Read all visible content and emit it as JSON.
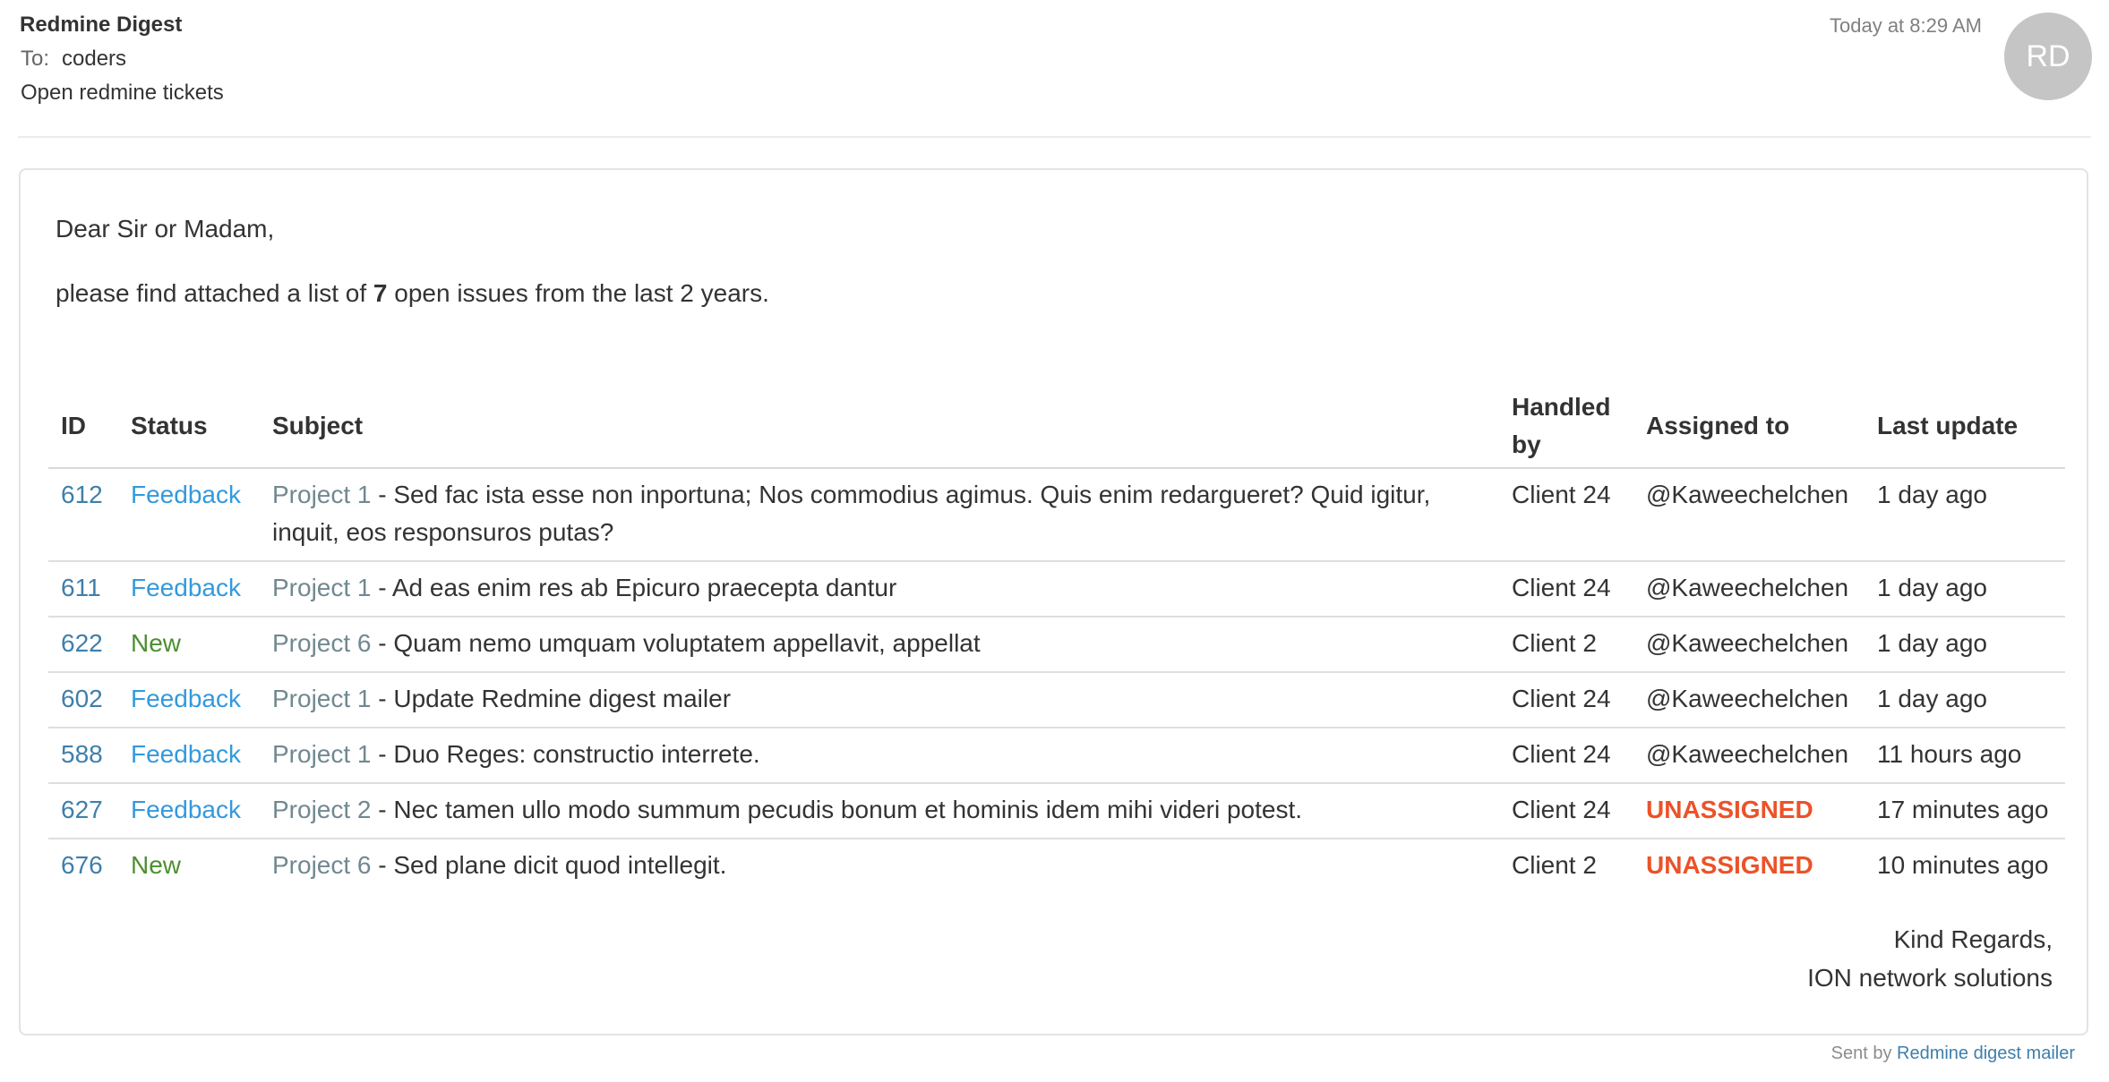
{
  "mail": {
    "sender": "Redmine Digest",
    "to_label": "To:",
    "to_value": "coders",
    "subject": "Open redmine tickets",
    "timestamp": "Today at 8:29 AM",
    "avatar_initials": "RD"
  },
  "body": {
    "greeting": "Dear Sir or Madam,",
    "intro_prefix": "please find attached a list of ",
    "intro_count": "7",
    "intro_suffix": " open issues from the last 2 years.",
    "closing_line1": "Kind Regards,",
    "closing_line2": "ION network solutions"
  },
  "table": {
    "headers": [
      "ID",
      "Status",
      "Subject",
      "Handled by",
      "Assigned to",
      "Last update"
    ],
    "rows": [
      {
        "id": "612",
        "status": "Feedback",
        "status_type": "feedback",
        "project": "Project 1",
        "subject": " - Sed fac ista esse non inportuna; Nos commodius agimus. Quis enim redargueret? Quid igitur, inquit, eos responsuros putas?",
        "handled_by": "Client 24",
        "assigned_to": "@Kaweechelchen",
        "assigned_type": "user",
        "last_update": "1 day ago"
      },
      {
        "id": "611",
        "status": "Feedback",
        "status_type": "feedback",
        "project": "Project 1",
        "subject": " - Ad eas enim res ab Epicuro praecepta dantur",
        "handled_by": "Client 24",
        "assigned_to": "@Kaweechelchen",
        "assigned_type": "user",
        "last_update": "1 day ago"
      },
      {
        "id": "622",
        "status": "New",
        "status_type": "new",
        "project": "Project 6",
        "subject": " - Quam nemo umquam voluptatem appellavit, appellat",
        "handled_by": "Client 2",
        "assigned_to": "@Kaweechelchen",
        "assigned_type": "user",
        "last_update": "1 day ago"
      },
      {
        "id": "602",
        "status": "Feedback",
        "status_type": "feedback",
        "project": "Project 1",
        "subject": " - Update Redmine digest mailer",
        "handled_by": "Client 24",
        "assigned_to": "@Kaweechelchen",
        "assigned_type": "user",
        "last_update": "1 day ago"
      },
      {
        "id": "588",
        "status": "Feedback",
        "status_type": "feedback",
        "project": "Project 1",
        "subject": " - Duo Reges: constructio interrete.",
        "handled_by": "Client 24",
        "assigned_to": "@Kaweechelchen",
        "assigned_type": "user",
        "last_update": "11 hours ago"
      },
      {
        "id": "627",
        "status": "Feedback",
        "status_type": "feedback",
        "project": "Project 2",
        "subject": " - Nec tamen ullo modo summum pecudis bonum et hominis idem mihi videri potest.",
        "handled_by": "Client 24",
        "assigned_to": "UNASSIGNED",
        "assigned_type": "unassigned",
        "last_update": "17 minutes ago"
      },
      {
        "id": "676",
        "status": "New",
        "status_type": "new",
        "project": "Project 6",
        "subject": " - Sed plane dicit quod intellegit.",
        "handled_by": "Client 2",
        "assigned_to": "UNASSIGNED",
        "assigned_type": "unassigned",
        "last_update": "10 minutes ago"
      }
    ]
  },
  "footer": {
    "prefix": "Sent by ",
    "link_text": "Redmine digest mailer"
  },
  "colors": {
    "status_feedback": "#3399dd",
    "status_new": "#4c8f2f",
    "id_link": "#3e7fab",
    "project_link": "#718891",
    "unassigned": "#ec5228",
    "avatar_bg": "#c5c5c5"
  }
}
